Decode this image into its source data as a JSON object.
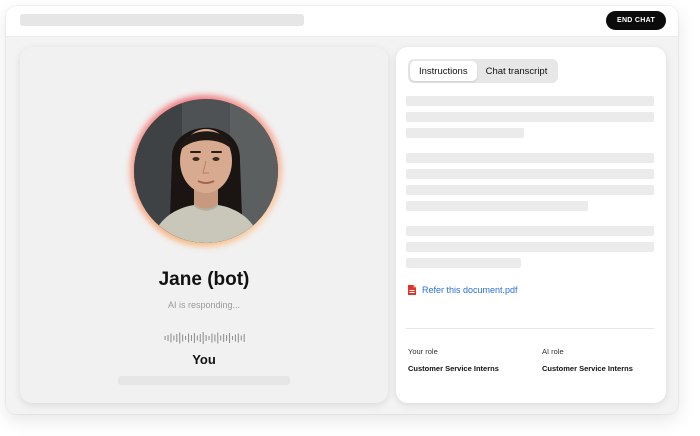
{
  "header": {
    "end_chat_label": "END CHAT"
  },
  "bot": {
    "name": "Jane (bot)",
    "status": "AI is responding..."
  },
  "user": {
    "label": "You"
  },
  "tabs": [
    {
      "label": "Instructions",
      "active": true
    },
    {
      "label": "Chat transcript",
      "active": false
    }
  ],
  "document": {
    "link_label": "Refer this document.pdf",
    "icon": "pdf-file-icon"
  },
  "roles": {
    "your_role_label": "Your role",
    "your_role_value": "Customer Service Interns",
    "ai_role_label": "AI role",
    "ai_role_value": "Customer Service Interns"
  },
  "colors": {
    "accent_link": "#2a6fdb",
    "button_dark": "#0b0b0b",
    "pdf_red": "#e0342b",
    "glow_start": "#f7b47a",
    "glow_end": "#f26d7a"
  }
}
